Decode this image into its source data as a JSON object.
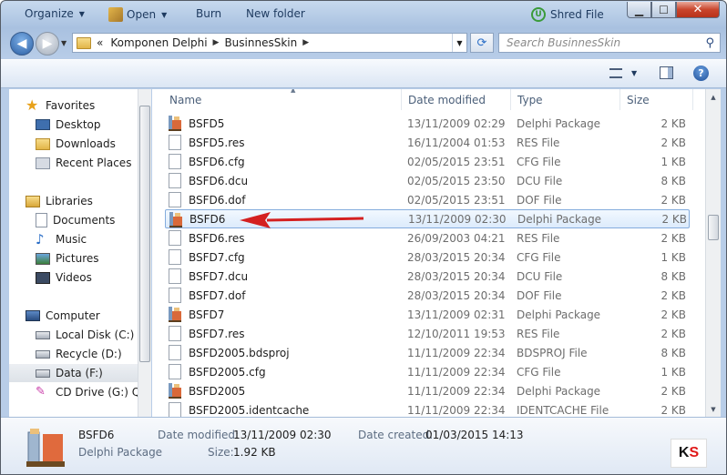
{
  "window": {
    "minimize": "▁",
    "maximize": "☐",
    "close": "✕"
  },
  "address": {
    "overflow": "«",
    "crumbs": [
      "Komponen Delphi",
      "BusinnesSkin"
    ]
  },
  "search": {
    "placeholder": "Search BusinnesSkin"
  },
  "toolbar": {
    "organize": "Organize",
    "open": "Open",
    "burn": "Burn",
    "new_folder": "New folder",
    "shred": "Shred File"
  },
  "nav": {
    "favorites": "Favorites",
    "desktop": "Desktop",
    "downloads": "Downloads",
    "recent_places": "Recent Places",
    "libraries": "Libraries",
    "documents": "Documents",
    "music": "Music",
    "pictures": "Pictures",
    "videos": "Videos",
    "computer": "Computer",
    "local_disk": "Local Disk (C:)",
    "recycle": "Recycle (D:)",
    "data": "Data (F:)",
    "cd_drive": "CD Drive (G:) Qui"
  },
  "columns": {
    "name": "Name",
    "date": "Date modified",
    "type": "Type",
    "size": "Size"
  },
  "files": [
    {
      "name": "BSFD5",
      "date": "13/11/2009 02:29",
      "type": "Delphi Package",
      "size": "2 KB",
      "icon": "package"
    },
    {
      "name": "BSFD5.res",
      "date": "16/11/2004 01:53",
      "type": "RES File",
      "size": "2 KB",
      "icon": "document"
    },
    {
      "name": "BSFD6.cfg",
      "date": "02/05/2015 23:51",
      "type": "CFG File",
      "size": "1 KB",
      "icon": "document"
    },
    {
      "name": "BSFD6.dcu",
      "date": "02/05/2015 23:50",
      "type": "DCU File",
      "size": "8 KB",
      "icon": "document"
    },
    {
      "name": "BSFD6.dof",
      "date": "02/05/2015 23:51",
      "type": "DOF File",
      "size": "2 KB",
      "icon": "document"
    },
    {
      "name": "BSFD6",
      "date": "13/11/2009 02:30",
      "type": "Delphi Package",
      "size": "2 KB",
      "icon": "package"
    },
    {
      "name": "BSFD6.res",
      "date": "26/09/2003 04:21",
      "type": "RES File",
      "size": "2 KB",
      "icon": "document"
    },
    {
      "name": "BSFD7.cfg",
      "date": "28/03/2015 20:34",
      "type": "CFG File",
      "size": "1 KB",
      "icon": "document"
    },
    {
      "name": "BSFD7.dcu",
      "date": "28/03/2015 20:34",
      "type": "DCU File",
      "size": "8 KB",
      "icon": "document"
    },
    {
      "name": "BSFD7.dof",
      "date": "28/03/2015 20:34",
      "type": "DOF File",
      "size": "2 KB",
      "icon": "document"
    },
    {
      "name": "BSFD7",
      "date": "13/11/2009 02:31",
      "type": "Delphi Package",
      "size": "2 KB",
      "icon": "package"
    },
    {
      "name": "BSFD7.res",
      "date": "12/10/2011 19:53",
      "type": "RES File",
      "size": "2 KB",
      "icon": "document"
    },
    {
      "name": "BSFD2005.bdsproj",
      "date": "11/11/2009 22:34",
      "type": "BDSPROJ File",
      "size": "8 KB",
      "icon": "document"
    },
    {
      "name": "BSFD2005.cfg",
      "date": "11/11/2009 22:34",
      "type": "CFG File",
      "size": "1 KB",
      "icon": "document"
    },
    {
      "name": "BSFD2005",
      "date": "11/11/2009 22:34",
      "type": "Delphi Package",
      "size": "2 KB",
      "icon": "package"
    },
    {
      "name": "BSFD2005.identcache",
      "date": "11/11/2009 22:34",
      "type": "IDENTCACHE File",
      "size": "2 KB",
      "icon": "document"
    }
  ],
  "selected_index": 5,
  "details": {
    "name": "BSFD6",
    "type": "Delphi Package",
    "modified_label": "Date modified:",
    "modified": "13/11/2009 02:30",
    "created_label": "Date created:",
    "created": "01/03/2015 14:13",
    "size_label": "Size:",
    "size": "1.92 KB"
  },
  "watermark": "KS",
  "colors": {
    "arrow": "#d42020",
    "selection_border": "#84acdd",
    "ks_k": "#111111",
    "ks_s": "#e01818"
  }
}
